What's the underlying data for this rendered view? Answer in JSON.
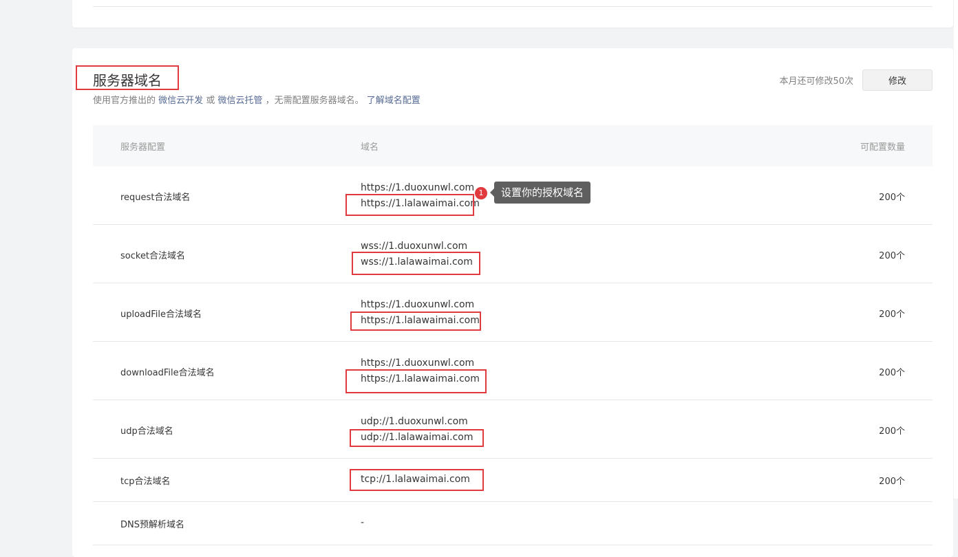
{
  "section": {
    "title": "服务器域名",
    "desc_prefix": "使用官方推出的",
    "link_cloud_dev": "微信云开发",
    "desc_or": "或",
    "link_cloud_host": "微信云托管",
    "desc_suffix": "，无需配置服务器域名。",
    "link_learn": "了解域名配置",
    "quota_text": "本月还可修改50次",
    "modify_label": "修改"
  },
  "table": {
    "headers": [
      "服务器配置",
      "域名",
      "可配置数量"
    ],
    "rows": [
      {
        "name": "request合法域名",
        "domains": [
          "https://1.duoxunwl.com",
          "https://1.lalawaimai.com"
        ],
        "count": "200个"
      },
      {
        "name": "socket合法域名",
        "domains": [
          "wss://1.duoxunwl.com",
          "wss://1.lalawaimai.com"
        ],
        "count": "200个"
      },
      {
        "name": "uploadFile合法域名",
        "domains": [
          "https://1.duoxunwl.com",
          "https://1.lalawaimai.com"
        ],
        "count": "200个"
      },
      {
        "name": "downloadFile合法域名",
        "domains": [
          "https://1.duoxunwl.com",
          "https://1.lalawaimai.com"
        ],
        "count": "200个"
      },
      {
        "name": "udp合法域名",
        "domains": [
          "udp://1.duoxunwl.com",
          "udp://1.lalawaimai.com"
        ],
        "count": "200个"
      },
      {
        "name": "tcp合法域名",
        "domains": [
          "tcp://1.lalawaimai.com"
        ],
        "count": "200个"
      },
      {
        "name": "DNS预解析域名",
        "domains": [
          "-"
        ],
        "count": ""
      }
    ]
  },
  "annotation": {
    "badge": "1",
    "tooltip": "设置你的授权域名"
  },
  "colors": {
    "highlight": "#e0393e",
    "link": "#576b95",
    "tooltip_bg": "#5f5f5f"
  }
}
